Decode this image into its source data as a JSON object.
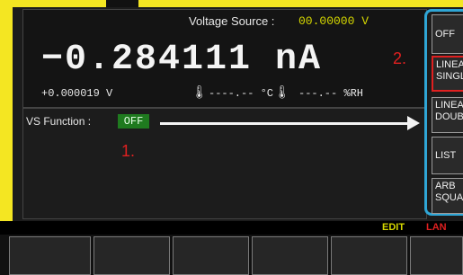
{
  "header": {
    "voltage_source_label": "Voltage Source :",
    "voltage_source_value": "00.00000  V"
  },
  "measurement": {
    "main_reading": "−0.284111 nA",
    "secondary_reading": "+0.000019  V",
    "temperature": "----.-- °C",
    "humidity": "---.-- %RH"
  },
  "vs_function": {
    "label": "VS Function :",
    "value": "OFF"
  },
  "annotations": {
    "one": "1.",
    "two": "2."
  },
  "softkeys": [
    {
      "label": "OFF"
    },
    {
      "label": "LINEAR\nSINGLE"
    },
    {
      "label": "LINEAR\nDOUBLE"
    },
    {
      "label": "LIST"
    },
    {
      "label": "ARB\nSQUARE"
    }
  ],
  "status": {
    "edit": "EDIT",
    "lan": "LAN"
  },
  "colors": {
    "bezel": "#f4e622",
    "highlight_frame": "#2fa6d6",
    "annotation": "#e02020",
    "status_on": "#1f7a1f"
  }
}
